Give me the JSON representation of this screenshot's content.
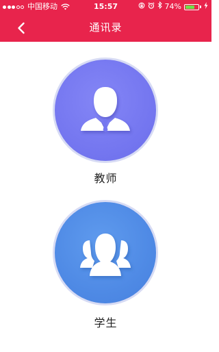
{
  "status_bar": {
    "carrier": "中国移动",
    "time": "15:57",
    "battery_percent": "74%",
    "battery_level": 0.74,
    "signal_strength": 3,
    "signal_max": 5,
    "colors": {
      "background": "#e8244c",
      "battery_fill": "#6fe04a"
    }
  },
  "nav_bar": {
    "title": "通讯录",
    "back_icon": "chevron-left-icon",
    "background": "#e8244c"
  },
  "entries": [
    {
      "id": "teacher",
      "label": "教师",
      "icon": "teacher-person-icon",
      "circle_color": "#7577f0"
    },
    {
      "id": "student",
      "label": "学生",
      "icon": "student-group-icon",
      "circle_color": "#4f8ae5"
    }
  ]
}
